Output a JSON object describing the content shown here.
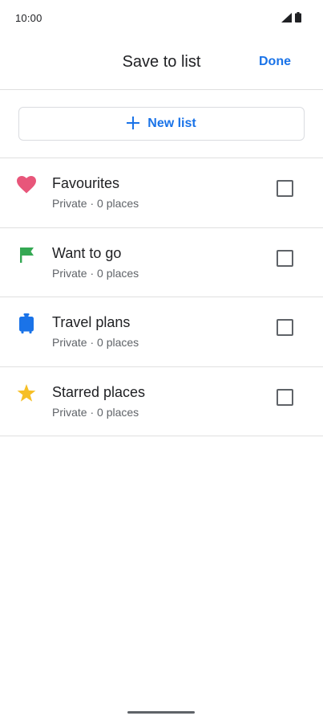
{
  "status_bar": {
    "time": "10:00",
    "icons": [
      "cellular-signal-icon",
      "battery-icon"
    ]
  },
  "app_bar": {
    "title": "Save to list",
    "done_label": "Done"
  },
  "new_list": {
    "label": "New list",
    "icon": "plus-icon"
  },
  "lists": [
    {
      "name": "Favourites",
      "subtitle": "Private · 0 places",
      "icon": "heart-icon",
      "color": "#e8567a",
      "checked": false
    },
    {
      "name": "Want to go",
      "subtitle": "Private · 0 places",
      "icon": "flag-icon",
      "color": "#34a853",
      "checked": false
    },
    {
      "name": "Travel plans",
      "subtitle": "Private · 0 places",
      "icon": "suitcase-icon",
      "color": "#1a73e8",
      "checked": false
    },
    {
      "name": "Starred places",
      "subtitle": "Private · 0 places",
      "icon": "star-icon",
      "color": "#f6bf26",
      "checked": false
    }
  ],
  "colors": {
    "accent": "#1a73e8",
    "text_primary": "#202124",
    "text_secondary": "#5f6368",
    "divider": "#e0e0e0"
  }
}
